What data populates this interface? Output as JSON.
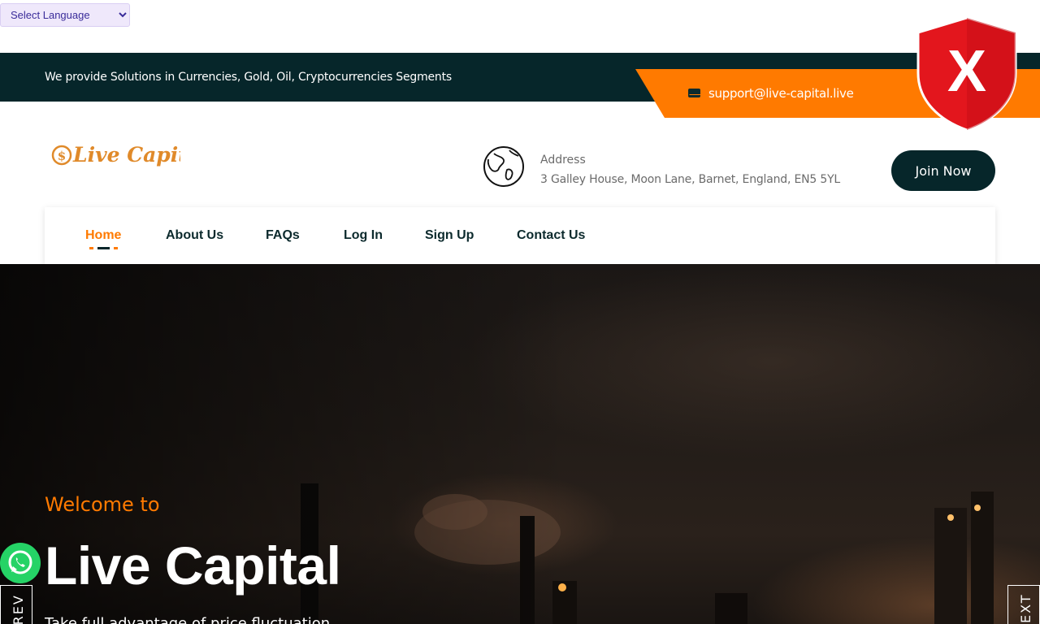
{
  "language_select": {
    "selected": "Select Language"
  },
  "topbar": {
    "tagline": "We provide Solutions in Currencies, Gold, Oil, Cryptocurrencies Segments",
    "email": "support@live-capital.live",
    "email_icon": "envelope-icon"
  },
  "badge": {
    "letter": "X",
    "icon": "shield-x-icon",
    "color": "#e3161d"
  },
  "header": {
    "logo_text": "Live Capital",
    "address_label": "Address",
    "address_value": "3 Galley House, Moon Lane, Barnet, England, EN5 5YL",
    "address_icon": "globe-icon",
    "join_label": "Join Now"
  },
  "nav": {
    "items": [
      {
        "label": "Home",
        "active": true
      },
      {
        "label": "About Us"
      },
      {
        "label": "FAQs"
      },
      {
        "label": "Log In"
      },
      {
        "label": "Sign Up"
      },
      {
        "label": "Contact Us"
      }
    ]
  },
  "hero": {
    "welcome": "Welcome to",
    "title": "Live Capital",
    "subtitle": "Take full advantage of price fluctuation",
    "prev_label": "PREV",
    "next_label": "NEXT"
  },
  "colors": {
    "accent": "#ff7a00",
    "dark": "#06262a",
    "whatsapp": "#25d366"
  }
}
